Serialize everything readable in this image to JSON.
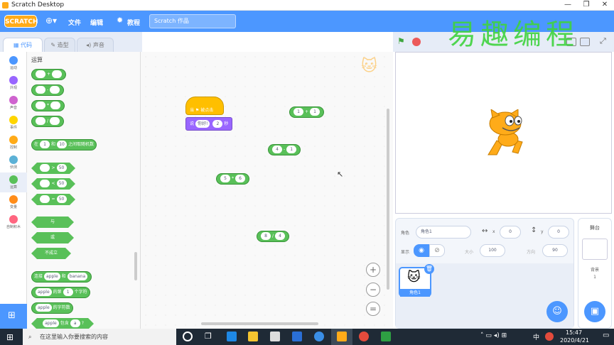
{
  "window": {
    "title": "Scratch Desktop",
    "controls": [
      "—",
      "❐",
      "✕"
    ]
  },
  "menubar": {
    "logo": "SCRATCH",
    "file": "文件",
    "edit": "编辑",
    "tutorials": "教程",
    "project_title": "Scratch 作品"
  },
  "tabs": [
    {
      "label": "代码"
    },
    {
      "label": "造型"
    },
    {
      "label": "声音"
    }
  ],
  "categories": [
    {
      "label": "运动",
      "color": "#4c97ff"
    },
    {
      "label": "外观",
      "color": "#9966ff"
    },
    {
      "label": "声音",
      "color": "#cf63cf"
    },
    {
      "label": "事件",
      "color": "#ffd500"
    },
    {
      "label": "控制",
      "color": "#ffab19"
    },
    {
      "label": "侦测",
      "color": "#5cb1d6"
    },
    {
      "label": "运算",
      "color": "#59c059"
    },
    {
      "label": "变量",
      "color": "#ff8c1a"
    },
    {
      "label": "自制积木",
      "color": "#ff6680"
    }
  ],
  "palette": {
    "heading": "运算",
    "ops": [
      "+",
      "-",
      "*",
      "/"
    ],
    "random": {
      "pre": "在",
      "a": "1",
      "mid": "和",
      "b": "10",
      "post": "之间取随机数"
    },
    "compare": [
      {
        "op": ">",
        "v": "50"
      },
      {
        "op": "<",
        "v": "50"
      },
      {
        "op": "=",
        "v": "50"
      }
    ],
    "logic": [
      "与",
      "或",
      "不成立"
    ],
    "join": {
      "pre": "连接",
      "a": "apple",
      "mid": "和",
      "b": "banana"
    },
    "letter": {
      "a": "apple",
      "mid": "的第",
      "n": "1",
      "post": "个字符"
    },
    "length": {
      "a": "apple",
      "post": "的字符数"
    },
    "contains": {
      "a": "apple",
      "mid": "包含",
      "b": "a",
      "post": "?"
    }
  },
  "script": {
    "hat": "当 ⚑ 被点击",
    "say": "说",
    "say_text": "你好!",
    "say_secs": "2",
    "secs": "秒"
  },
  "loose": [
    {
      "a": "1",
      "op": "+",
      "b": "1"
    },
    {
      "a": "4",
      "op": "-",
      "b": "1"
    },
    {
      "a": "5",
      "op": "*",
      "b": "6"
    },
    {
      "a": "8",
      "op": "/",
      "b": "4"
    }
  ],
  "zoom": [
    "+",
    "−",
    "="
  ],
  "watermark": "易趣编程",
  "sprite_info": {
    "sprite_label": "角色",
    "sprite_name": "角色1",
    "x_label": "x",
    "x": "0",
    "y_label": "y",
    "y": "0",
    "show_label": "显示",
    "size_label": "大小",
    "size": "100",
    "dir_label": "方向",
    "dir": "90"
  },
  "sprite_tile": {
    "name": "角色1"
  },
  "backdrop": {
    "title": "舞台",
    "label": "背景",
    "count": "1"
  },
  "taskbar": {
    "search": "在这里输入你要搜索的内容",
    "time": "15:47",
    "date": "2020/4/21",
    "ime": "中"
  }
}
